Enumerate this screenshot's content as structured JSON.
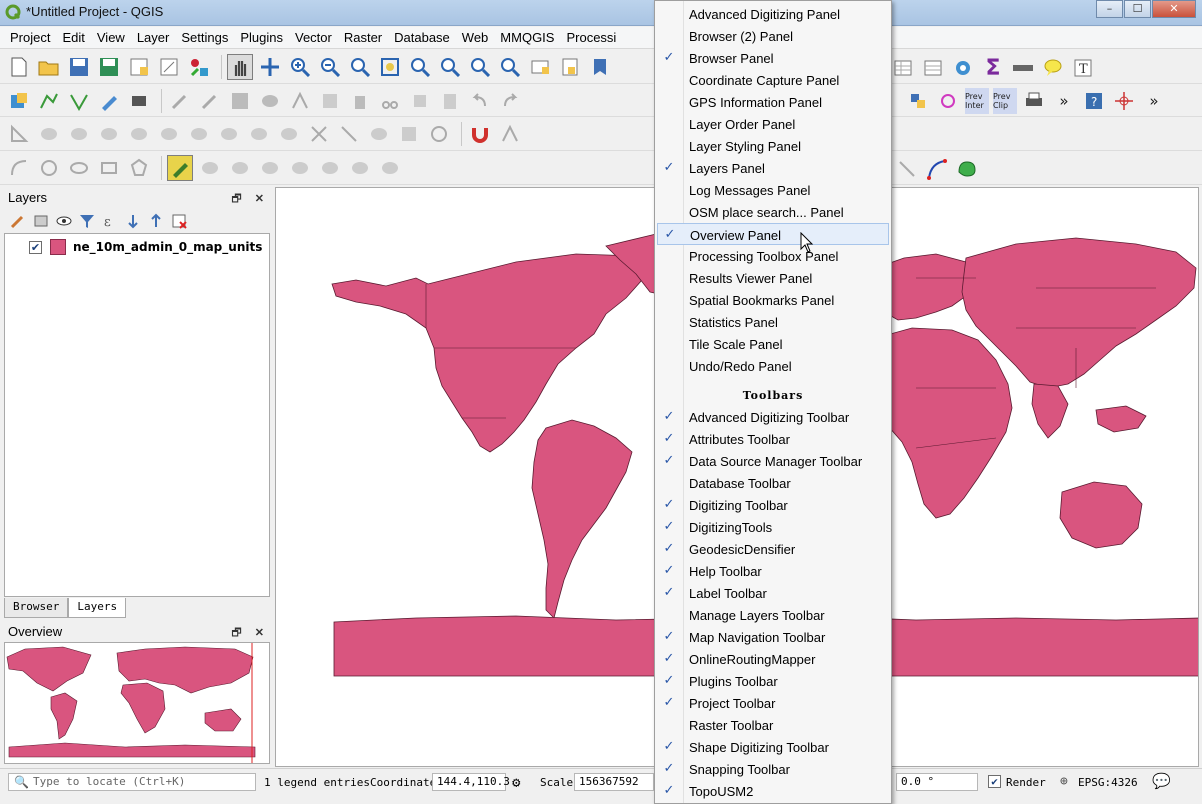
{
  "window": {
    "title": "*Untitled Project - QGIS",
    "controls": [
      "–",
      "☐",
      "✕"
    ]
  },
  "menubar": [
    "Project",
    "Edit",
    "View",
    "Layer",
    "Settings",
    "Plugins",
    "Vector",
    "Raster",
    "Database",
    "Web",
    "MMQGIS",
    "Processi"
  ],
  "toolbar_labels": {
    "prev_inter": "Prev Inter",
    "prev_clip": "Prev Clip"
  },
  "layers_panel": {
    "title": "Layers",
    "layer": {
      "name": "ne_10m_admin_0_map_units",
      "checked": true,
      "color": "#d9557f"
    },
    "tabs": [
      "Browser",
      "Layers"
    ]
  },
  "overview_panel": {
    "title": "Overview"
  },
  "colors": {
    "fill": "#d9557f",
    "stroke": "#5a1a30"
  },
  "context_menu": {
    "panels": [
      {
        "label": "Advanced Digitizing Panel",
        "checked": false
      },
      {
        "label": "Browser (2) Panel",
        "checked": false
      },
      {
        "label": "Browser Panel",
        "checked": true
      },
      {
        "label": "Coordinate Capture Panel",
        "checked": false
      },
      {
        "label": "GPS Information Panel",
        "checked": false
      },
      {
        "label": "Layer Order Panel",
        "checked": false
      },
      {
        "label": "Layer Styling Panel",
        "checked": false
      },
      {
        "label": "Layers Panel",
        "checked": true
      },
      {
        "label": "Log Messages Panel",
        "checked": false
      },
      {
        "label": "OSM place search... Panel",
        "checked": false
      },
      {
        "label": "Overview Panel",
        "checked": true,
        "hover": true
      },
      {
        "label": "Processing Toolbox Panel",
        "checked": false
      },
      {
        "label": "Results Viewer Panel",
        "checked": false
      },
      {
        "label": "Spatial Bookmarks Panel",
        "checked": false
      },
      {
        "label": "Statistics Panel",
        "checked": false
      },
      {
        "label": "Tile Scale Panel",
        "checked": false
      },
      {
        "label": "Undo/Redo Panel",
        "checked": false
      }
    ],
    "toolbars_title": "Toolbars",
    "toolbars": [
      {
        "label": "Advanced Digitizing Toolbar",
        "checked": true
      },
      {
        "label": "Attributes Toolbar",
        "checked": true
      },
      {
        "label": "Data Source Manager Toolbar",
        "checked": true
      },
      {
        "label": "Database Toolbar",
        "checked": false
      },
      {
        "label": "Digitizing Toolbar",
        "checked": true
      },
      {
        "label": "DigitizingTools",
        "checked": true
      },
      {
        "label": "GeodesicDensifier",
        "checked": true
      },
      {
        "label": "Help Toolbar",
        "checked": true
      },
      {
        "label": "Label Toolbar",
        "checked": true
      },
      {
        "label": "Manage Layers Toolbar",
        "checked": false
      },
      {
        "label": "Map Navigation Toolbar",
        "checked": true
      },
      {
        "label": "OnlineRoutingMapper",
        "checked": true
      },
      {
        "label": "Plugins Toolbar",
        "checked": true
      },
      {
        "label": "Project Toolbar",
        "checked": true
      },
      {
        "label": "Raster Toolbar",
        "checked": false
      },
      {
        "label": "Shape Digitizing Toolbar",
        "checked": true
      },
      {
        "label": "Snapping Toolbar",
        "checked": true
      },
      {
        "label": "TopoUSM2",
        "checked": true
      }
    ]
  },
  "statusbar": {
    "locate_placeholder": "Type to locate (Ctrl+K)",
    "legend_entries": "1 legend entries",
    "coordinate_label": "Coordinate",
    "coordinate_value": "144.4,110.3",
    "scale_label": "Scale",
    "scale_value": "156367592",
    "rotation_value": "0.0 °",
    "render_label": "Render",
    "crs": "EPSG:4326"
  }
}
